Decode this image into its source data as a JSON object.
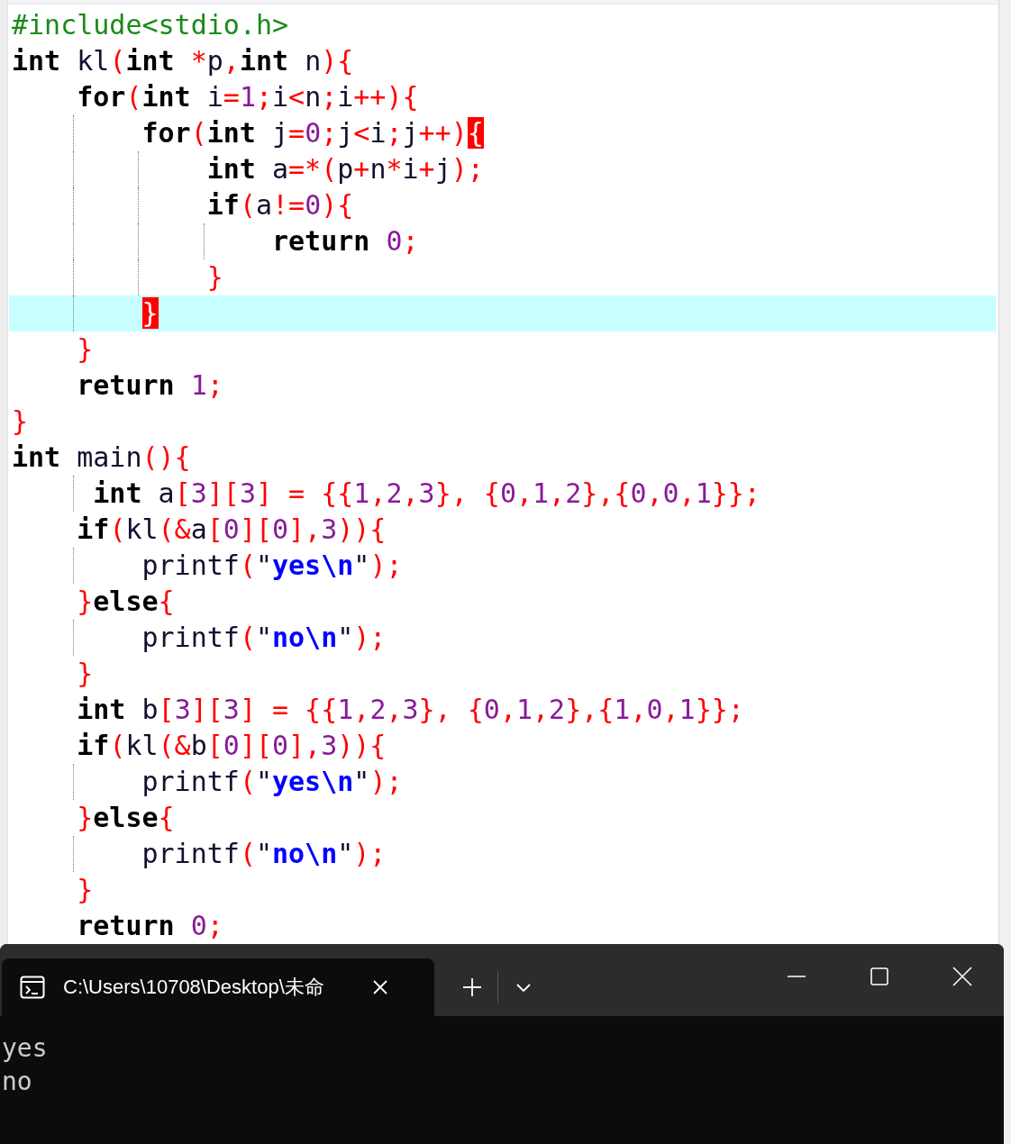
{
  "editor": {
    "lines": [
      {
        "current": false,
        "tokens": [
          {
            "kind": "pre",
            "text": "#include<stdio.h>"
          }
        ]
      },
      {
        "current": false,
        "tokens": [
          {
            "kind": "kw",
            "text": "int"
          },
          {
            "kind": "id",
            "text": " kl"
          },
          {
            "kind": "op",
            "text": "("
          },
          {
            "kind": "kw",
            "text": "int"
          },
          {
            "kind": "op",
            "text": " *"
          },
          {
            "kind": "id",
            "text": "p"
          },
          {
            "kind": "op",
            "text": ","
          },
          {
            "kind": "kw",
            "text": "int"
          },
          {
            "kind": "id",
            "text": " n"
          },
          {
            "kind": "op",
            "text": "){"
          }
        ]
      },
      {
        "current": false,
        "tokens": [
          {
            "kind": "kw",
            "text": "    for"
          },
          {
            "kind": "op",
            "text": "("
          },
          {
            "kind": "kw",
            "text": "int"
          },
          {
            "kind": "id",
            "text": " i"
          },
          {
            "kind": "op",
            "text": "="
          },
          {
            "kind": "num",
            "text": "1"
          },
          {
            "kind": "op",
            "text": ";"
          },
          {
            "kind": "id",
            "text": "i"
          },
          {
            "kind": "op",
            "text": "<"
          },
          {
            "kind": "id",
            "text": "n"
          },
          {
            "kind": "op",
            "text": ";"
          },
          {
            "kind": "id",
            "text": "i"
          },
          {
            "kind": "op",
            "text": "++){"
          }
        ]
      },
      {
        "current": false,
        "tokens": [
          {
            "kind": "kw",
            "text": "        for"
          },
          {
            "kind": "op",
            "text": "("
          },
          {
            "kind": "kw",
            "text": "int"
          },
          {
            "kind": "id",
            "text": " j"
          },
          {
            "kind": "op",
            "text": "="
          },
          {
            "kind": "num",
            "text": "0"
          },
          {
            "kind": "op",
            "text": ";"
          },
          {
            "kind": "id",
            "text": "j"
          },
          {
            "kind": "op",
            "text": "<"
          },
          {
            "kind": "id",
            "text": "i"
          },
          {
            "kind": "op",
            "text": ";"
          },
          {
            "kind": "id",
            "text": "j"
          },
          {
            "kind": "op",
            "text": "++)"
          },
          {
            "kind": "match",
            "text": "{"
          }
        ]
      },
      {
        "current": false,
        "tokens": [
          {
            "kind": "kw",
            "text": "            int"
          },
          {
            "kind": "id",
            "text": " a"
          },
          {
            "kind": "op",
            "text": "=*("
          },
          {
            "kind": "id",
            "text": "p"
          },
          {
            "kind": "op",
            "text": "+"
          },
          {
            "kind": "id",
            "text": "n"
          },
          {
            "kind": "op",
            "text": "*"
          },
          {
            "kind": "id",
            "text": "i"
          },
          {
            "kind": "op",
            "text": "+"
          },
          {
            "kind": "id",
            "text": "j"
          },
          {
            "kind": "op",
            "text": ");"
          }
        ]
      },
      {
        "current": false,
        "tokens": [
          {
            "kind": "kw",
            "text": "            if"
          },
          {
            "kind": "op",
            "text": "("
          },
          {
            "kind": "id",
            "text": "a"
          },
          {
            "kind": "op",
            "text": "!="
          },
          {
            "kind": "num",
            "text": "0"
          },
          {
            "kind": "op",
            "text": "){"
          }
        ]
      },
      {
        "current": false,
        "tokens": [
          {
            "kind": "kw",
            "text": "                return"
          },
          {
            "kind": "num",
            "text": " 0"
          },
          {
            "kind": "op",
            "text": ";"
          }
        ]
      },
      {
        "current": false,
        "tokens": [
          {
            "kind": "op",
            "text": "            }"
          }
        ]
      },
      {
        "current": true,
        "tokens": [
          {
            "kind": "match",
            "text": "        }"
          }
        ]
      },
      {
        "current": false,
        "tokens": [
          {
            "kind": "op",
            "text": "    }"
          }
        ]
      },
      {
        "current": false,
        "tokens": [
          {
            "kind": "kw",
            "text": "    return"
          },
          {
            "kind": "num",
            "text": " 1"
          },
          {
            "kind": "op",
            "text": ";"
          }
        ]
      },
      {
        "current": false,
        "tokens": [
          {
            "kind": "op",
            "text": "}"
          }
        ]
      },
      {
        "current": false,
        "tokens": [
          {
            "kind": "kw",
            "text": "int"
          },
          {
            "kind": "id",
            "text": " main"
          },
          {
            "kind": "op",
            "text": "(){"
          }
        ]
      },
      {
        "current": false,
        "tokens": [
          {
            "kind": "kw",
            "text": "     int"
          },
          {
            "kind": "id",
            "text": " a"
          },
          {
            "kind": "op",
            "text": "["
          },
          {
            "kind": "num",
            "text": "3"
          },
          {
            "kind": "op",
            "text": "]["
          },
          {
            "kind": "num",
            "text": "3"
          },
          {
            "kind": "op",
            "text": "] = {{"
          },
          {
            "kind": "num",
            "text": "1"
          },
          {
            "kind": "op",
            "text": ","
          },
          {
            "kind": "num",
            "text": "2"
          },
          {
            "kind": "op",
            "text": ","
          },
          {
            "kind": "num",
            "text": "3"
          },
          {
            "kind": "op",
            "text": "}, {"
          },
          {
            "kind": "num",
            "text": "0"
          },
          {
            "kind": "op",
            "text": ","
          },
          {
            "kind": "num",
            "text": "1"
          },
          {
            "kind": "op",
            "text": ","
          },
          {
            "kind": "num",
            "text": "2"
          },
          {
            "kind": "op",
            "text": "},{"
          },
          {
            "kind": "num",
            "text": "0"
          },
          {
            "kind": "op",
            "text": ","
          },
          {
            "kind": "num",
            "text": "0"
          },
          {
            "kind": "op",
            "text": ","
          },
          {
            "kind": "num",
            "text": "1"
          },
          {
            "kind": "op",
            "text": "}};"
          }
        ]
      },
      {
        "current": false,
        "tokens": [
          {
            "kind": "kw",
            "text": "    if"
          },
          {
            "kind": "op",
            "text": "("
          },
          {
            "kind": "id",
            "text": "kl"
          },
          {
            "kind": "op",
            "text": "(&"
          },
          {
            "kind": "id",
            "text": "a"
          },
          {
            "kind": "op",
            "text": "["
          },
          {
            "kind": "num",
            "text": "0"
          },
          {
            "kind": "op",
            "text": "]["
          },
          {
            "kind": "num",
            "text": "0"
          },
          {
            "kind": "op",
            "text": "],"
          },
          {
            "kind": "num",
            "text": "3"
          },
          {
            "kind": "op",
            "text": ")){"
          }
        ]
      },
      {
        "current": false,
        "tokens": [
          {
            "kind": "id",
            "text": "        printf"
          },
          {
            "kind": "op",
            "text": "("
          },
          {
            "kind": "id",
            "text": "\""
          },
          {
            "kind": "str",
            "text": "yes\\n"
          },
          {
            "kind": "id",
            "text": "\""
          },
          {
            "kind": "op",
            "text": ");"
          }
        ]
      },
      {
        "current": false,
        "tokens": [
          {
            "kind": "op",
            "text": "    }"
          },
          {
            "kind": "kw",
            "text": "else"
          },
          {
            "kind": "op",
            "text": "{"
          }
        ]
      },
      {
        "current": false,
        "tokens": [
          {
            "kind": "id",
            "text": "        printf"
          },
          {
            "kind": "op",
            "text": "("
          },
          {
            "kind": "id",
            "text": "\""
          },
          {
            "kind": "str",
            "text": "no\\n"
          },
          {
            "kind": "id",
            "text": "\""
          },
          {
            "kind": "op",
            "text": ");"
          }
        ]
      },
      {
        "current": false,
        "tokens": [
          {
            "kind": "op",
            "text": "    }"
          }
        ]
      },
      {
        "current": false,
        "tokens": [
          {
            "kind": "kw",
            "text": "    int"
          },
          {
            "kind": "id",
            "text": " b"
          },
          {
            "kind": "op",
            "text": "["
          },
          {
            "kind": "num",
            "text": "3"
          },
          {
            "kind": "op",
            "text": "]["
          },
          {
            "kind": "num",
            "text": "3"
          },
          {
            "kind": "op",
            "text": "] = {{"
          },
          {
            "kind": "num",
            "text": "1"
          },
          {
            "kind": "op",
            "text": ","
          },
          {
            "kind": "num",
            "text": "2"
          },
          {
            "kind": "op",
            "text": ","
          },
          {
            "kind": "num",
            "text": "3"
          },
          {
            "kind": "op",
            "text": "}, {"
          },
          {
            "kind": "num",
            "text": "0"
          },
          {
            "kind": "op",
            "text": ","
          },
          {
            "kind": "num",
            "text": "1"
          },
          {
            "kind": "op",
            "text": ","
          },
          {
            "kind": "num",
            "text": "2"
          },
          {
            "kind": "op",
            "text": "},{"
          },
          {
            "kind": "num",
            "text": "1"
          },
          {
            "kind": "op",
            "text": ","
          },
          {
            "kind": "num",
            "text": "0"
          },
          {
            "kind": "op",
            "text": ","
          },
          {
            "kind": "num",
            "text": "1"
          },
          {
            "kind": "op",
            "text": "}};"
          }
        ]
      },
      {
        "current": false,
        "tokens": [
          {
            "kind": "kw",
            "text": "    if"
          },
          {
            "kind": "op",
            "text": "("
          },
          {
            "kind": "id",
            "text": "kl"
          },
          {
            "kind": "op",
            "text": "(&"
          },
          {
            "kind": "id",
            "text": "b"
          },
          {
            "kind": "op",
            "text": "["
          },
          {
            "kind": "num",
            "text": "0"
          },
          {
            "kind": "op",
            "text": "]["
          },
          {
            "kind": "num",
            "text": "0"
          },
          {
            "kind": "op",
            "text": "],"
          },
          {
            "kind": "num",
            "text": "3"
          },
          {
            "kind": "op",
            "text": ")){"
          }
        ]
      },
      {
        "current": false,
        "tokens": [
          {
            "kind": "id",
            "text": "        printf"
          },
          {
            "kind": "op",
            "text": "("
          },
          {
            "kind": "id",
            "text": "\""
          },
          {
            "kind": "str",
            "text": "yes\\n"
          },
          {
            "kind": "id",
            "text": "\""
          },
          {
            "kind": "op",
            "text": ");"
          }
        ]
      },
      {
        "current": false,
        "tokens": [
          {
            "kind": "op",
            "text": "    }"
          },
          {
            "kind": "kw",
            "text": "else"
          },
          {
            "kind": "op",
            "text": "{"
          }
        ]
      },
      {
        "current": false,
        "tokens": [
          {
            "kind": "id",
            "text": "        printf"
          },
          {
            "kind": "op",
            "text": "("
          },
          {
            "kind": "id",
            "text": "\""
          },
          {
            "kind": "str",
            "text": "no\\n"
          },
          {
            "kind": "id",
            "text": "\""
          },
          {
            "kind": "op",
            "text": ");"
          }
        ]
      },
      {
        "current": false,
        "tokens": [
          {
            "kind": "op",
            "text": "    }"
          }
        ]
      },
      {
        "current": false,
        "tokens": [
          {
            "kind": "kw",
            "text": "    return"
          },
          {
            "kind": "num",
            "text": " 0"
          },
          {
            "kind": "op",
            "text": ";"
          }
        ]
      }
    ]
  },
  "terminal": {
    "tab": {
      "title": "C:\\Users\\10708\\Desktop\\未命"
    },
    "output": [
      "yes",
      "no"
    ]
  }
}
